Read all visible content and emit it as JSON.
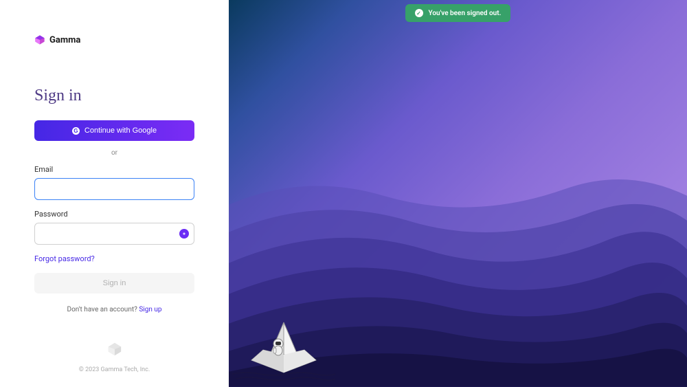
{
  "brand": {
    "name": "Gamma"
  },
  "heading": "Sign in",
  "google_button": "Continue with Google",
  "divider": "or",
  "fields": {
    "email_label": "Email",
    "password_label": "Password"
  },
  "forgot_link": "Forgot password?",
  "signin_button": "Sign in",
  "signup": {
    "prompt": "Don't have an account? ",
    "link": "Sign up"
  },
  "footer": "© 2023 Gamma Tech, Inc.",
  "toast": {
    "message": "You've been signed out."
  }
}
